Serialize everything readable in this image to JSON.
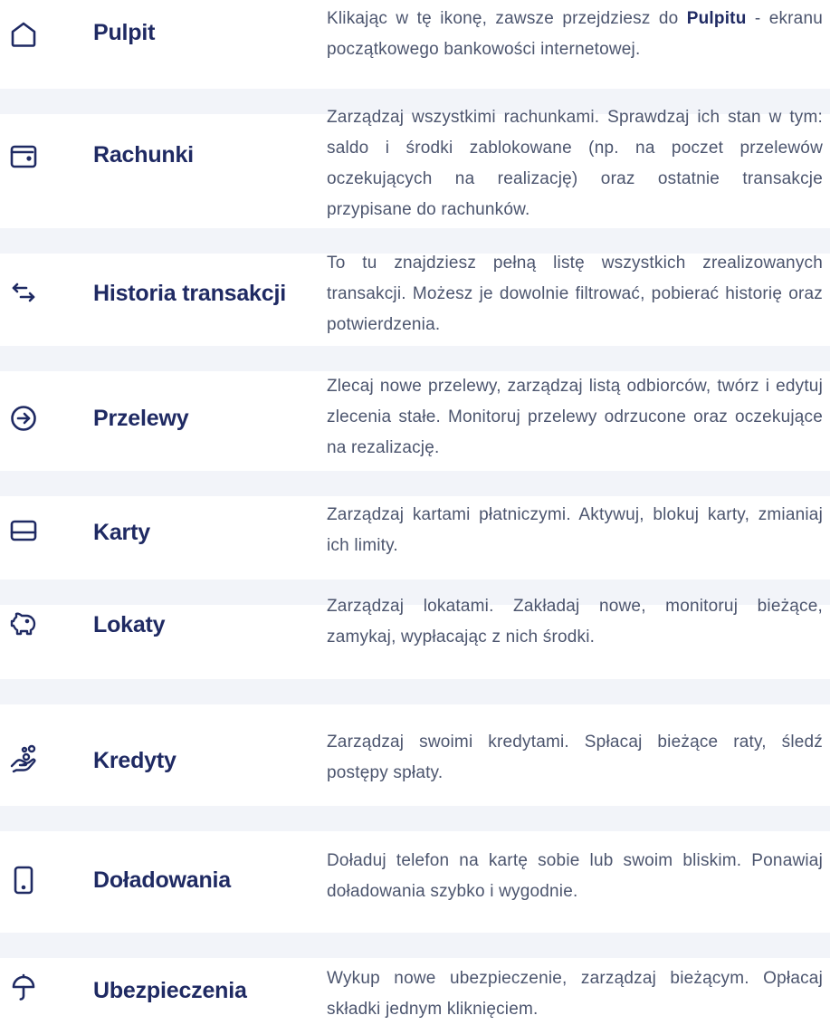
{
  "items": [
    {
      "label": "Pulpit",
      "icon": "home-icon",
      "text": "Klikając w tę ikonę,  zawsze przejdziesz do ",
      "text_bold": "Pulpitu",
      "text_after": " - ekranu początkowego bankowości internetowej."
    },
    {
      "label": "Rachunki",
      "icon": "wallet-icon",
      "text": "Zarządzaj wszystkimi rachunkami. Sprawdzaj ich stan w tym: saldo  i środki zablokowane (np. na poczet przelewów oczekujących na realizację) oraz ostatnie transakcje przypisane do rachunków."
    },
    {
      "label": "Historia transakcji",
      "icon": "arrows-left-right-icon",
      "text": "To tu znajdziesz pełną listę wszystkich zrealizowanych transakcji. Możesz je dowolnie filtrować, pobierać historię oraz potwierdzenia."
    },
    {
      "label": "Przelewy",
      "icon": "arrow-circle-right-icon",
      "text": "Zlecaj nowe przelewy, zarządzaj listą odbiorców, twórz i edytuj zlecenia stałe. Monitoruj przelewy odrzucone oraz oczekujące na rezalizację."
    },
    {
      "label": "Karty",
      "icon": "card-icon",
      "text": "Zarządzaj kartami płatniczymi. Aktywuj, blokuj karty, zmianiaj ich limity."
    },
    {
      "label": "Lokaty",
      "icon": "piggy-bank-icon",
      "text": "Zarządzaj lokatami. Zakładaj nowe, monitoruj bieżące, zamykaj, wypłacając z nich środki."
    },
    {
      "label": "Kredyty",
      "icon": "hand-coins-icon",
      "text": "Zarządzaj swoimi kredytami. Spłacaj bieżące raty, śledź postępy spłaty."
    },
    {
      "label": "Doładowania",
      "icon": "phone-icon",
      "text": "Doładuj telefon na kartę sobie lub swoim bliskim. Ponawiaj doładowania szybko i wygodnie."
    },
    {
      "label": "Ubezpieczenia",
      "icon": "umbrella-icon",
      "text": "Wykup nowe ubezpieczenie, zarządzaj bieżącym. Opłacaj składki jednym kliknięciem."
    }
  ],
  "colors": {
    "label": "#1f2a63",
    "text": "#4c556e",
    "icon": "#1f2a63",
    "divider": "#f2f4f9"
  }
}
